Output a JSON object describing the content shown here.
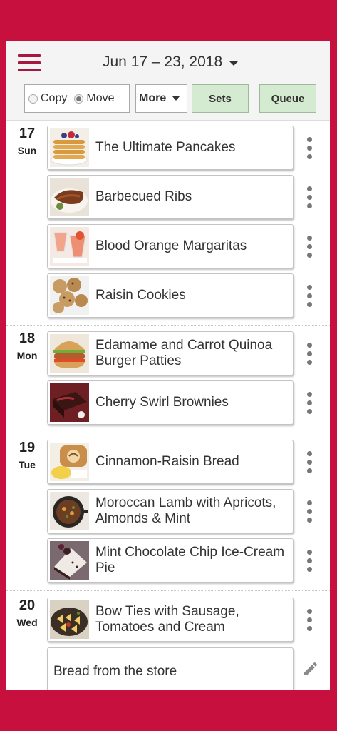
{
  "header": {
    "date_range": "Jun 17 – 23, 2018",
    "copy_label": "Copy",
    "move_label": "Move",
    "selected_mode": "Move",
    "more_label": "More",
    "sets_label": "Sets",
    "queue_label": "Queue"
  },
  "colors": {
    "frame": "#c8103f",
    "menu_icon": "#a8173e",
    "green_button": "#d5ebd1"
  },
  "days": [
    {
      "number": "17",
      "name": "Sun",
      "items": [
        {
          "title": "The Ultimate Pancakes",
          "thumb": "pancakes-thumbnail"
        },
        {
          "title": "Barbecued Ribs",
          "thumb": "ribs-thumbnail"
        },
        {
          "title": "Blood Orange Margaritas",
          "thumb": "margaritas-thumbnail"
        },
        {
          "title": "Raisin Cookies",
          "thumb": "cookies-thumbnail"
        }
      ]
    },
    {
      "number": "18",
      "name": "Mon",
      "items": [
        {
          "title": "Edamame and Carrot Quinoa Burger Patties",
          "thumb": "burger-thumbnail"
        },
        {
          "title": "Cherry Swirl Brownies",
          "thumb": "brownies-thumbnail"
        }
      ]
    },
    {
      "number": "19",
      "name": "Tue",
      "items": [
        {
          "title": "Cinnamon-Raisin Bread",
          "thumb": "bread-thumbnail"
        },
        {
          "title": "Moroccan Lamb with Apricots, Almonds & Mint",
          "thumb": "lamb-thumbnail"
        },
        {
          "title": "Mint Chocolate Chip Ice-Cream Pie",
          "thumb": "pie-thumbnail"
        }
      ]
    },
    {
      "number": "20",
      "name": "Wed",
      "items": [
        {
          "title": "Bow Ties with Sausage, Tomatoes and Cream",
          "thumb": "pasta-thumbnail"
        }
      ],
      "note": "Bread from the store"
    }
  ],
  "icons": {
    "menu": "hamburger-menu-icon",
    "dropdown": "caret-down-icon",
    "item_menu": "vertical-ellipsis-icon",
    "edit": "pencil-icon"
  }
}
